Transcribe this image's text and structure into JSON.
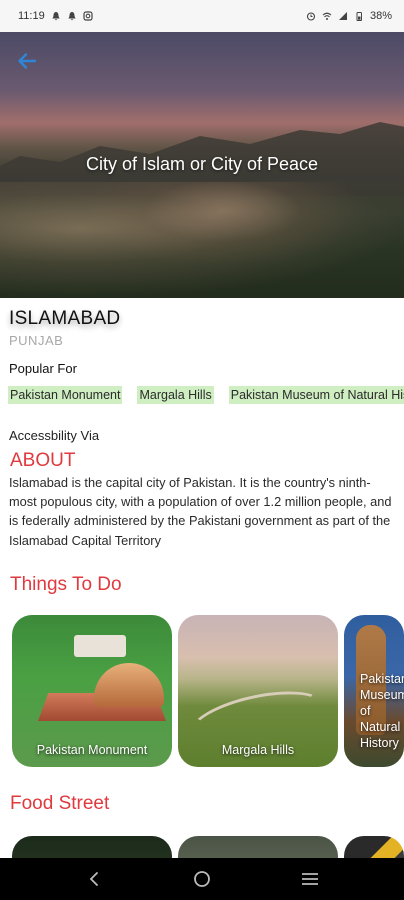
{
  "status_bar": {
    "time": "11:19",
    "battery": "38%",
    "left_icons": [
      "notification-bell-icon",
      "notification-bell-icon",
      "instagram-icon"
    ],
    "right_icons": [
      "alarm-icon",
      "wifi-icon",
      "signal-icon",
      "battery-icon"
    ]
  },
  "hero": {
    "tagline": "City of Islam or City of Peace",
    "back_icon": "back-arrow-icon",
    "accent_color": "#2f86d6"
  },
  "city": {
    "name": "ISLAMABAD",
    "province": "PUNJAB"
  },
  "popular": {
    "label": "Popular For",
    "chips": [
      "Pakistan Monument",
      "Margala Hills",
      "Pakistan Museum of Natural History"
    ]
  },
  "accessibility": {
    "label": "Accessbility Via"
  },
  "about": {
    "heading": "ABOUT",
    "text": "Islamabad is the capital city of Pakistan. It is the country's ninth-most populous city, with a population of over 1.2 million people, and is federally administered by the Pakistani government as part of the Islamabad Capital Territory"
  },
  "things_to_do": {
    "heading": "Things To Do",
    "cards": [
      {
        "label": "Pakistan Monument"
      },
      {
        "label": "Margala Hills"
      },
      {
        "label": "Pakistan Museum of Natural History"
      }
    ]
  },
  "food_street": {
    "heading": "Food Street"
  },
  "nav": {
    "icons": [
      "back-nav-icon",
      "home-nav-icon",
      "menu-nav-icon"
    ]
  },
  "colors": {
    "heading": "#e0393e",
    "chip_bg": "#cfeec2",
    "nav_bar": "#000000"
  }
}
